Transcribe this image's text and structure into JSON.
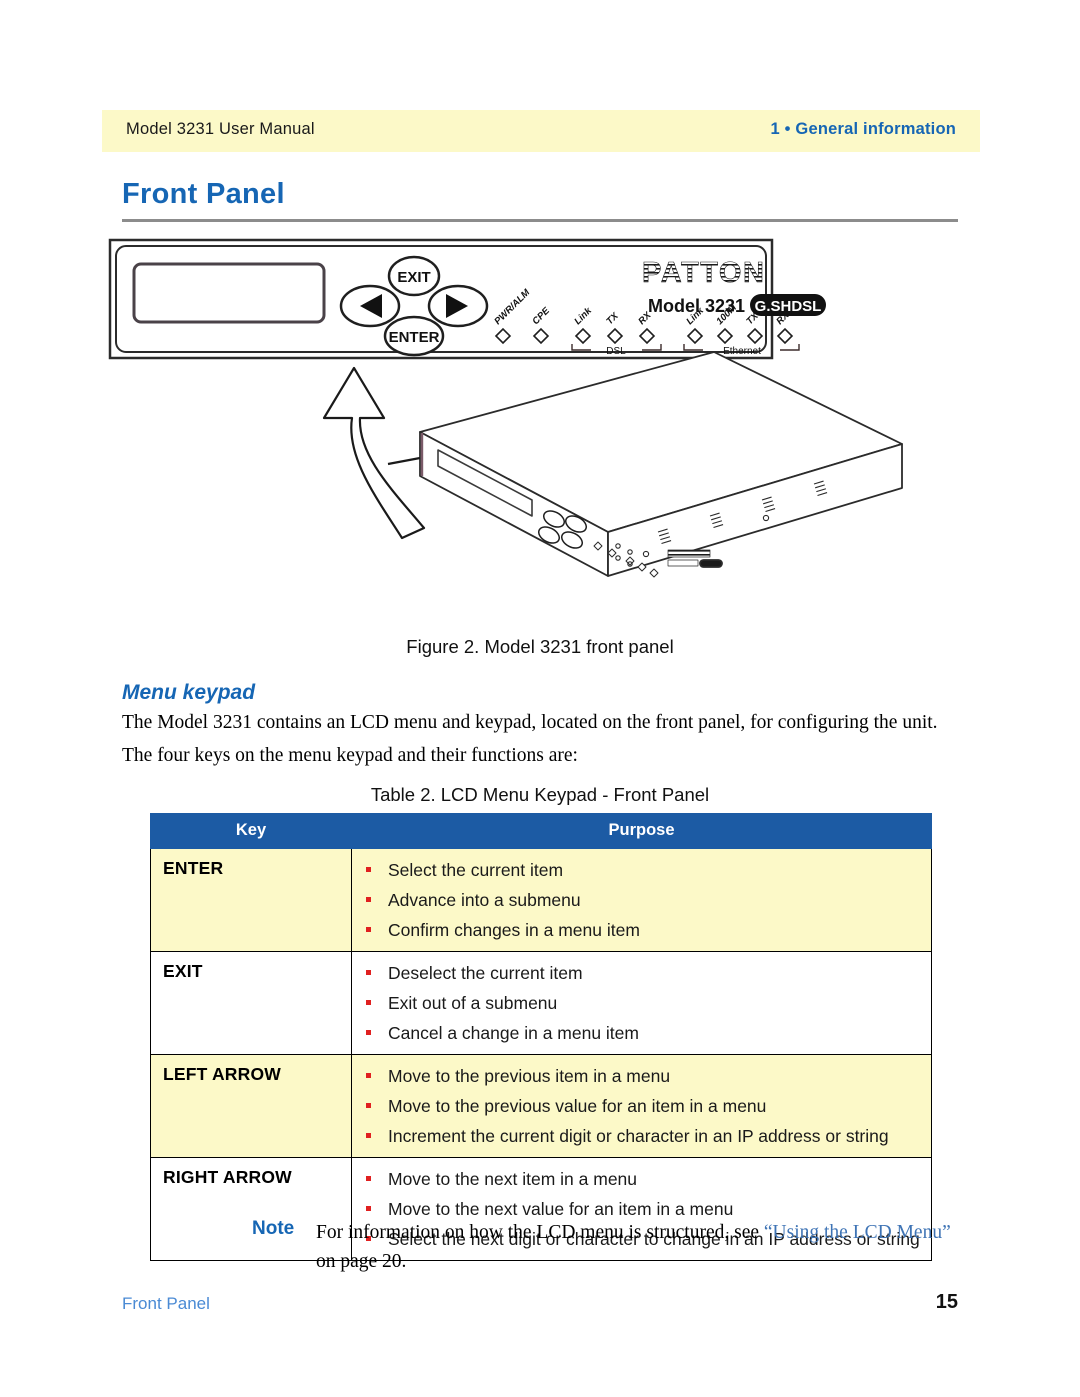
{
  "header": {
    "left": "Model 3231 User Manual",
    "right": "1 • General information"
  },
  "page_title": "Front Panel",
  "figure": {
    "caption": "Figure 2. Model 3231 front panel",
    "panel": {
      "brand": "PATTON",
      "model_label": "Model 3231",
      "badge": "G.SHDSL",
      "keys": {
        "exit": "EXIT",
        "enter": "ENTER",
        "left_arrow": "◀",
        "right_arrow": "▶"
      },
      "leds": [
        {
          "label": "PWR/ALM",
          "group": ""
        },
        {
          "label": "CPE",
          "group": ""
        },
        {
          "label": "Link",
          "group": "DSL"
        },
        {
          "label": "TX",
          "group": "DSL"
        },
        {
          "label": "RX",
          "group": "DSL"
        },
        {
          "label": "Link",
          "group": "Ethernet"
        },
        {
          "label": "100M",
          "group": "Ethernet"
        },
        {
          "label": "TX",
          "group": "Ethernet"
        },
        {
          "label": "RX",
          "group": "Ethernet"
        }
      ],
      "group_labels": {
        "dsl": "DSL",
        "ethernet": "Ethernet"
      }
    }
  },
  "sub_heading": "Menu keypad",
  "paragraphs": {
    "p1": "The Model 3231 contains an LCD menu and keypad, located on the front panel, for configuring the unit.",
    "p2": "The four keys on the menu keypad and their functions are:"
  },
  "table": {
    "caption": "Table 2. LCD Menu Keypad - Front Panel",
    "columns": [
      "Key",
      "Purpose"
    ],
    "rows": [
      {
        "key": "ENTER",
        "purposes": [
          "Select the current item",
          "Advance into a submenu",
          "Confirm changes in a menu item"
        ]
      },
      {
        "key": "EXIT",
        "purposes": [
          "Deselect the current item",
          "Exit out of a submenu",
          "Cancel a change in a menu item"
        ]
      },
      {
        "key": "LEFT ARROW",
        "purposes": [
          "Move to the previous item in a menu",
          "Move to the previous value for an item in a menu",
          "Increment the current digit or character in an IP address or string"
        ]
      },
      {
        "key": "RIGHT ARROW",
        "purposes": [
          "Move to the next item in a menu",
          "Move to the next value for an item in a menu",
          "Select the next digit or character to change in an IP address or string"
        ]
      }
    ]
  },
  "note": {
    "label": "Note",
    "text_before": "For information on how the LCD menu is structured, see ",
    "link": "“Using the LCD Menu”",
    "text_after": " on page 20."
  },
  "footer": {
    "left": "Front Panel",
    "page_number": "15"
  },
  "colors": {
    "band": "#fcf9c8",
    "accent_blue": "#1666b4",
    "table_header": "#1c5ba4",
    "bullet_red": "#e02020",
    "link_blue": "#3f74b5"
  }
}
